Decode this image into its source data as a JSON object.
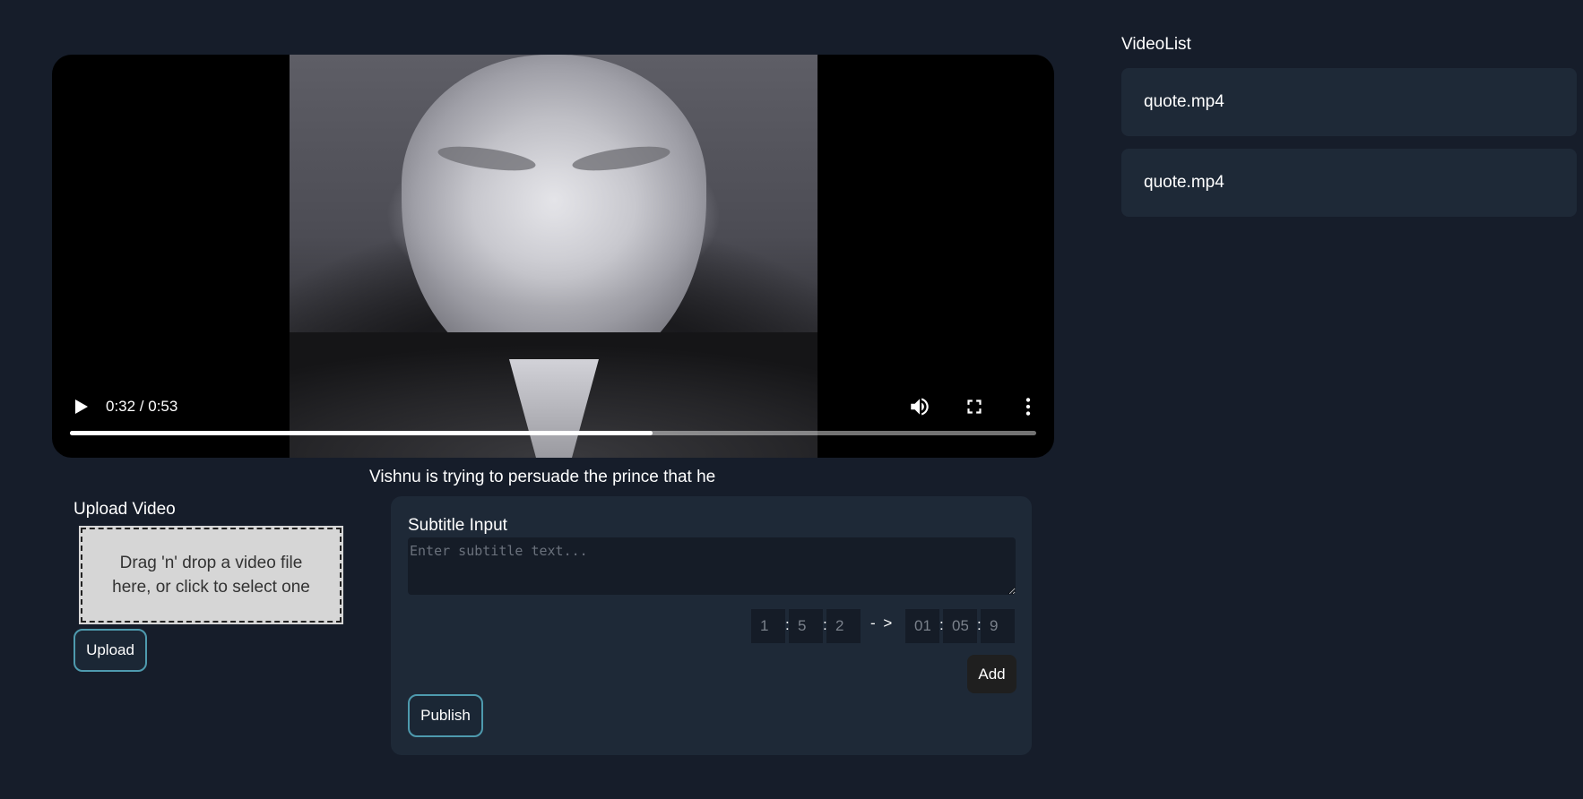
{
  "player": {
    "current_time": "0:32",
    "duration": "0:53",
    "time_display": "0:32 / 0:53",
    "progress_fraction": 0.603,
    "icons": [
      "play-icon",
      "volume-icon",
      "fullscreen-icon",
      "more-vert-icon"
    ]
  },
  "caption": "Vishnu is trying to persuade the prince that he",
  "upload": {
    "title": "Upload Video",
    "dropzone_text": "Drag 'n' drop a video file here, or click to select one",
    "button_label": "Upload"
  },
  "subtitle": {
    "label": "Subtitle Input",
    "placeholder": "Enter subtitle text...",
    "start": {
      "h": "1",
      "m": "5",
      "s": "2"
    },
    "arrow": "- >",
    "end": {
      "h": "01",
      "m": "05",
      "s": "9"
    },
    "add_label": "Add",
    "publish_label": "Publish"
  },
  "video_list": {
    "title": "VideoList",
    "items": [
      {
        "label": "quote.mp4"
      },
      {
        "label": "quote.mp4"
      }
    ]
  },
  "colors": {
    "background": "#161d2a",
    "panel": "#1e2937",
    "accent_border": "#4e9aae",
    "dropzone": "#d6d6d6"
  }
}
